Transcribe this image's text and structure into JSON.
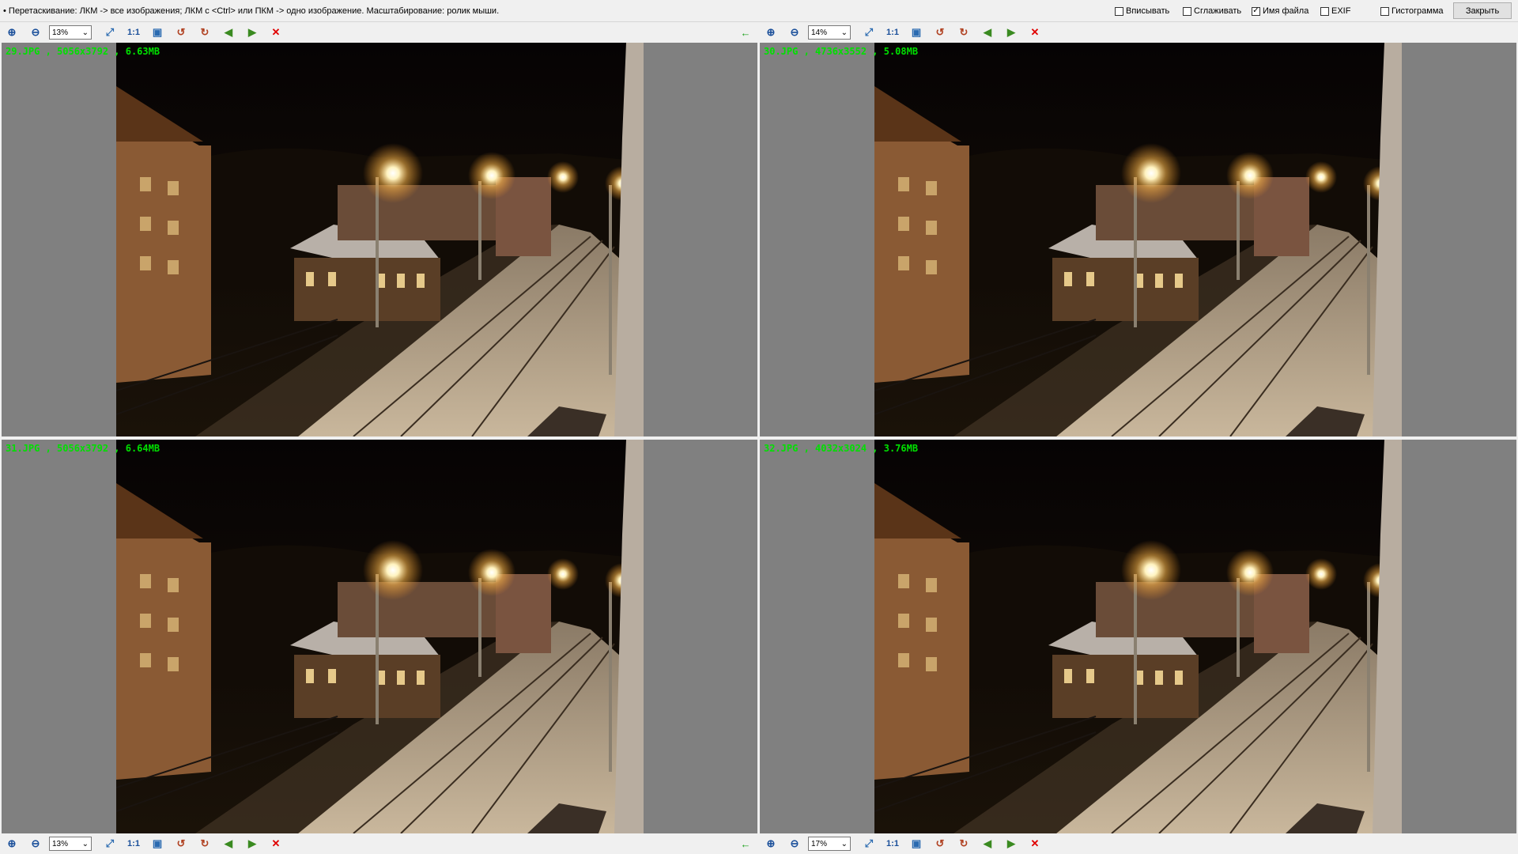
{
  "top": {
    "hint": "• Перетаскивание: ЛКМ -> все изображения; ЛКМ с <Ctrl> или ПКМ -> одно изображение. Масштабирование: ролик мыши.",
    "options": [
      {
        "label": "Вписывать",
        "checked": false
      },
      {
        "label": "Сглаживать",
        "checked": false
      },
      {
        "label": "Имя файла",
        "checked": true
      },
      {
        "label": "EXIF",
        "checked": false
      },
      {
        "label": "Гистограмма",
        "checked": false
      }
    ],
    "close_label": "Закрыть"
  },
  "toolbars": {
    "top_left": {
      "zoom": "13%"
    },
    "top_right": {
      "zoom": "14%"
    },
    "bottom_left": {
      "zoom": "13%"
    },
    "bottom_right": {
      "zoom": "17%"
    }
  },
  "toolbar_buttons": {
    "zoom_in_icon": "⊕",
    "zoom_out_icon": "⊖",
    "fit_icon": "⤢",
    "one_to_one": "1:1",
    "full_icon": "▣",
    "rotate_left_icon": "↺",
    "rotate_right_icon": "↻",
    "prev_icon": "◀",
    "next_icon": "▶",
    "close_icon": "✕",
    "back_icon": "←"
  },
  "images": [
    {
      "label": "29.JPG , 5056x3792 , 6.63MB"
    },
    {
      "label": "30.JPG , 4736x3552 , 5.08MB"
    },
    {
      "label": "31.JPG , 5056x3792 , 6.64MB"
    },
    {
      "label": "32.JPG , 4032x3024 , 3.76MB"
    }
  ],
  "colors": {
    "label_green": "#00e000",
    "pane_gray": "#808080",
    "close_red": "#e00000",
    "arrow_green": "#1aa01a"
  }
}
